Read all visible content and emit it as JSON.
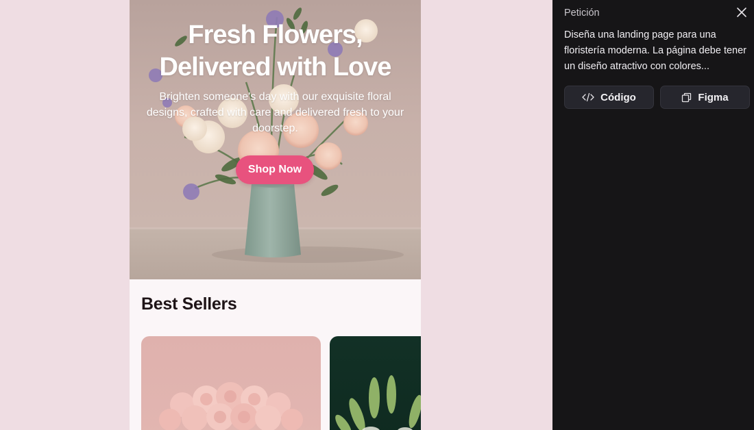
{
  "preview": {
    "hero": {
      "title_line1": "Fresh Flowers,",
      "title_line2": "Delivered with Love",
      "subtitle": "Brighten someone's day with our exquisite floral designs, crafted with care and delivered fresh to your doorstep.",
      "cta_label": "Shop Now"
    },
    "best_sellers": {
      "heading": "Best Sellers"
    }
  },
  "panel": {
    "title": "Petición",
    "prompt": "Diseña una landing page para una floristería moderna. La página debe tener un diseño atractivo con colores...",
    "code_button": "Código",
    "figma_button": "Figma",
    "close_icon": "close-icon"
  },
  "colors": {
    "page_background": "#efdde3",
    "accent_pink": "#e8527e",
    "panel_background": "#161517",
    "button_background": "#26262d"
  }
}
